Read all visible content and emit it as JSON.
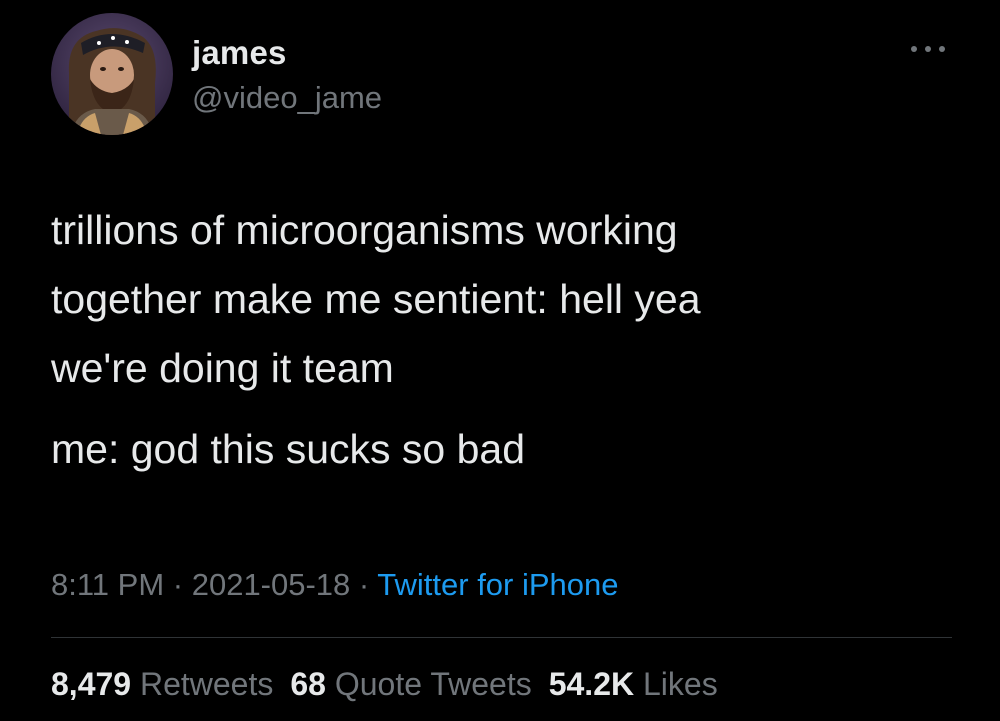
{
  "user": {
    "display_name": "james",
    "handle": "@video_jame",
    "avatar_icon": "profile-photo-avatar"
  },
  "tweet": {
    "paragraph_1_line_1": "trillions of microorganisms working",
    "paragraph_1_line_2": "together make me sentient: hell yea",
    "paragraph_1_line_3": "we're doing it team",
    "paragraph_2": "me: god this sucks so bad"
  },
  "meta": {
    "time": "8:11 PM",
    "separator": " · ",
    "date": "2021-05-18",
    "source": "Twitter for iPhone"
  },
  "stats": {
    "retweets_count": "8,479",
    "retweets_label": "Retweets",
    "quote_tweets_count": "68",
    "quote_tweets_label": "Quote Tweets",
    "likes_count": "54.2K",
    "likes_label": "Likes"
  },
  "icons": {
    "more": "more-options-icon"
  },
  "colors": {
    "background": "#000000",
    "primary_text": "#e7e9ea",
    "secondary_text": "#71767b",
    "accent_link": "#1d9bf0",
    "divider": "#2f3336"
  }
}
